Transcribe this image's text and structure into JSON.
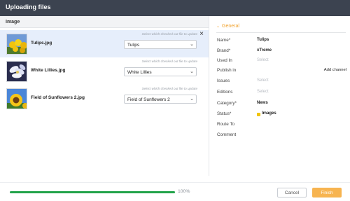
{
  "window": {
    "title": "Uploading files"
  },
  "left_panel": {
    "header": "Image",
    "files": [
      {
        "name": "Tulips.jpg",
        "hint": "Select which checked out file to update",
        "selected_option": "Tulips",
        "thumb_icon": "tulips-thumbnail"
      },
      {
        "name": "White Lillies.jpg",
        "hint": "Select which checked out file to update",
        "selected_option": "White Lillies",
        "thumb_icon": "white-lillies-thumbnail"
      },
      {
        "name": "Field of Sunflowers 2.jpg",
        "hint": "Select which checked out file to update",
        "selected_option": "Field of Sunflowers 2",
        "thumb_icon": "sunflowers-thumbnail"
      }
    ]
  },
  "right_panel": {
    "section_title": "General",
    "fields": {
      "name": {
        "label": "Name*",
        "value": "Tulips"
      },
      "brand": {
        "label": "Brand*",
        "value": "xTreme"
      },
      "used_in": {
        "label": "Used In",
        "placeholder": "Select"
      },
      "publish_in": {
        "label": "Publish in",
        "action": "Add channel"
      },
      "issues": {
        "label": "Issues",
        "placeholder": "Select"
      },
      "editions": {
        "label": "Editions",
        "placeholder": "Select"
      },
      "category": {
        "label": "Category*",
        "value": "News"
      },
      "status": {
        "label": "Status*",
        "value": "Images",
        "color": "#f1c40f"
      },
      "route_to": {
        "label": "Route To"
      },
      "comment": {
        "label": "Comment"
      }
    }
  },
  "footer": {
    "progress_percent": 100,
    "progress_text": "100%",
    "cancel_label": "Cancel",
    "finish_label": "Finish"
  },
  "colors": {
    "titlebar": "#3c4350",
    "accent": "#f0a22e",
    "progress": "#22a34a",
    "finish_button": "#f7b450",
    "selected_row": "#e6eefb"
  }
}
